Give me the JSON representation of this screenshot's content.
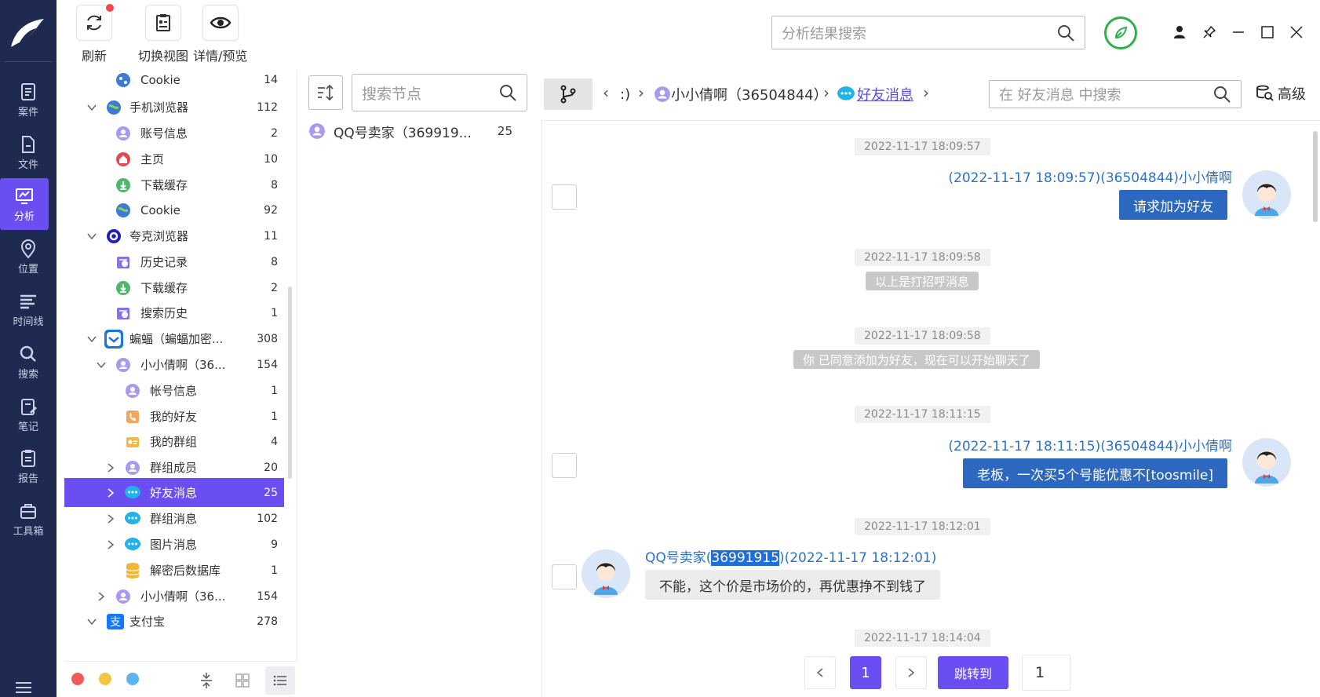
{
  "nav": {
    "items": [
      {
        "label": "案件",
        "icon": "case-icon"
      },
      {
        "label": "文件",
        "icon": "file-icon"
      },
      {
        "label": "分析",
        "icon": "analysis-icon"
      },
      {
        "label": "位置",
        "icon": "location-icon"
      },
      {
        "label": "时间线",
        "icon": "timeline-icon"
      },
      {
        "label": "搜索",
        "icon": "search-icon"
      },
      {
        "label": "笔记",
        "icon": "note-icon"
      },
      {
        "label": "报告",
        "icon": "report-icon"
      },
      {
        "label": "工具箱",
        "icon": "toolbox-icon"
      }
    ],
    "active": "分析"
  },
  "toolbar": {
    "refresh_label": "刷新",
    "switch_view_label": "切换视图",
    "detail_preview_label": "详情/预览",
    "search_placeholder": "分析结果搜索"
  },
  "tree": {
    "rows": [
      {
        "label": "Cookie",
        "count": "14",
        "icon": "cookie-icon"
      },
      {
        "label": "手机浏览器",
        "count": "112",
        "icon": "mobile-browser-icon"
      },
      {
        "label": "账号信息",
        "count": "2",
        "icon": "account-icon"
      },
      {
        "label": "主页",
        "count": "10",
        "icon": "home-icon"
      },
      {
        "label": "下载缓存",
        "count": "8",
        "icon": "download-icon"
      },
      {
        "label": "Cookie",
        "count": "92",
        "icon": "cookie-icon"
      },
      {
        "label": "夸克浏览器",
        "count": "11",
        "icon": "quark-browser-icon"
      },
      {
        "label": "历史记录",
        "count": "8",
        "icon": "history-icon"
      },
      {
        "label": "下载缓存",
        "count": "2",
        "icon": "download-icon"
      },
      {
        "label": "搜索历史",
        "count": "1",
        "icon": "search-history-icon"
      },
      {
        "label": "蝙蝠（蝙蝠加密...",
        "count": "308",
        "icon": "batchat-icon"
      },
      {
        "label": "小小倩啊（36...",
        "count": "154",
        "icon": "user-icon"
      },
      {
        "label": "帐号信息",
        "count": "1",
        "icon": "account-icon"
      },
      {
        "label": "我的好友",
        "count": "1",
        "icon": "friends-icon"
      },
      {
        "label": "我的群组",
        "count": "4",
        "icon": "groups-icon"
      },
      {
        "label": "群组成员",
        "count": "20",
        "icon": "group-member-icon"
      },
      {
        "label": "好友消息",
        "count": "25",
        "icon": "chat-bubble-icon"
      },
      {
        "label": "群组消息",
        "count": "102",
        "icon": "chat-bubble-icon"
      },
      {
        "label": "图片消息",
        "count": "9",
        "icon": "chat-bubble-icon"
      },
      {
        "label": "解密后数据库",
        "count": "1",
        "icon": "database-icon"
      },
      {
        "label": "小小倩啊（36...",
        "count": "154",
        "icon": "user-icon"
      },
      {
        "label": "支付宝",
        "count": "278",
        "icon": "alipay-icon"
      }
    ]
  },
  "node_panel": {
    "search_placeholder": "搜索节点",
    "items": [
      {
        "label": "QQ号卖家（369919...",
        "count": "25"
      }
    ]
  },
  "breadcrumb": {
    "first": ":)",
    "user": "小小倩啊（36504844）",
    "current": "好友消息",
    "search_placeholder": "在 好友消息 中搜索",
    "advanced_label": "高级"
  },
  "messages": {
    "m1_time": "2022-11-17 18:09:57",
    "m1_header": "(2022-11-17 18:09:57)(36504844)小小倩啊",
    "m1_text": "请求加为好友",
    "m2_time": "2022-11-17 18:09:58",
    "m2_text": "以上是打招呼消息",
    "m3_time": "2022-11-17 18:09:58",
    "m3_text": "你 已同意添加为好友，现在可以开始聊天了",
    "m4_time": "2022-11-17 18:11:15",
    "m4_header": "(2022-11-17 18:11:15)(36504844)小小倩啊",
    "m4_text": "老板，一次买5个号能优惠不[toosmile]",
    "m5_time": "2022-11-17 18:12:01",
    "m5_name": "QQ号卖家(",
    "m5_id": "36991915",
    "m5_time_suffix": ")(2022-11-17 18:12:01)",
    "m5_text": "不能，这个价是市场价的，再优惠挣不到钱了",
    "m6_time": "2022-11-17 18:14:04"
  },
  "pager": {
    "current_page": "1",
    "jump_label": "跳转到",
    "jump_value": "1"
  },
  "colors": {
    "sidebar": "#1e2a4f",
    "accent": "#6b4ef2",
    "outgoing_bubble": "#2c68bf",
    "link_blue": "#2e72c7",
    "status_green": "#2fb04a"
  }
}
